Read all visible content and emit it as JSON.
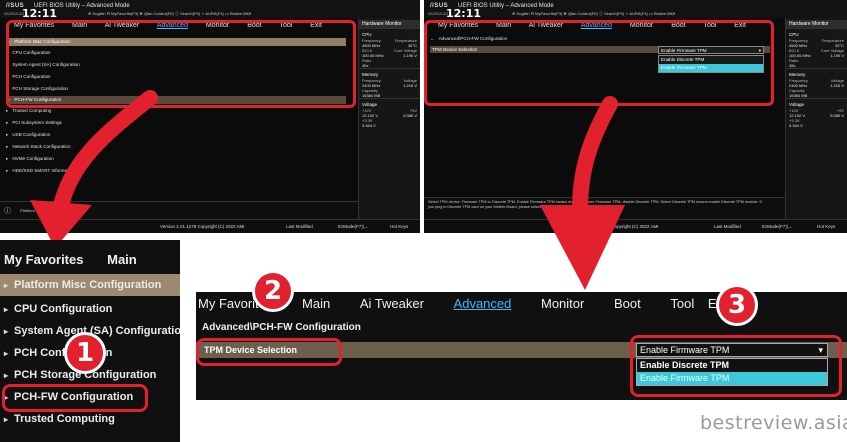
{
  "bios": {
    "logo": "/ISUS",
    "title": "UEFI BIOS Utility – Advanced Mode",
    "date": "05/20/2022",
    "time": "12:11",
    "toolbar": "⊕ English  ⊡ MyFavorite(F3)  ✥ Qfan Control(F6)  ⓘ Search(F9)  ✧ AURA(F4)  ▭ Resize BAR",
    "menu": [
      "My Favorites",
      "Main",
      "Ai Tweaker",
      "Advanced",
      "Monitor",
      "Boot",
      "Tool",
      "Exit"
    ],
    "active_menu": "Advanced",
    "advanced_items": [
      "Platform Misc Configuration",
      "CPU Configuration",
      "System Agent (SA) Configuration",
      "PCH Configuration",
      "PCH Storage Configuration",
      "PCH-FW Configuration",
      "Trusted Computing",
      "PCI Subsystem Settings",
      "USB Configuration",
      "Network Stack Configuration",
      "NVMe Configuration",
      "HDD/SSD SMART Information"
    ],
    "help_left": "Platform Misc Configuration",
    "footer_version": "Version 2.21.1278 Copyright (C) 2022 AMI",
    "footer_version_right": "Version 2.21.1278 Copyright (C) 2022 AMI",
    "last_modified": "Last Modified",
    "ezmode": "EzMode(F7)|→",
    "hotkeys": "Hot Keys",
    "breadcrumb": "Advanced\\PCH-FW Configuration",
    "tpm_label": "TPM Device Selection",
    "tpm_value": "Enable Firmware TPM",
    "tpm_options": [
      "Enable Discrete TPM",
      "Enable Firmware TPM"
    ],
    "tpm_help": "Select TPM device: Firmware TPM or Discrete TPM. Enable Firmware TPM means enable platform Firmware TPM, disable Discrete TPM. Select Discrete TPM means enable Discrete TPM module. If you plug in Discrete TPM card on your Mother Board, please select this option to Discrete TPM."
  },
  "hw_monitor": {
    "title": "Hardware Monitor",
    "cpu": "CPU",
    "freq_label": "Frequency",
    "freq": "4500 MHz",
    "temp_label": "Temperature",
    "temp": "32°C",
    "bclk_label": "BCLK",
    "bclk": "100.00 MHz",
    "corev_label": "Core Voltage",
    "corev": "1.190 V",
    "ratio_label": "Ratio",
    "ratio": "45x",
    "memory": "Memory",
    "mfreq_label": "Frequency",
    "mfreq": "2400 MHz",
    "mvolt_label": "Voltage",
    "mvolt": "1.216 V",
    "cap_label": "Capacity",
    "cap": "16384 MB",
    "voltage": "Voltage",
    "v12_label": "+12V",
    "v12": "12.192 V",
    "v5_label": "+5V",
    "v5": "5.080 V",
    "v33_label": "+3.3V",
    "v33": "3.344 V"
  },
  "zoom_left": {
    "menu_favorites": "My Favorites",
    "menu_main": "Main",
    "items": [
      "Platform Misc Configuration",
      "CPU Configuration",
      "System Agent (SA) Configuration",
      "PCH Configuration",
      "PCH Storage Configuration",
      "PCH-FW Configuration",
      "Trusted Computing"
    ],
    "badge": "1"
  },
  "zoom_right": {
    "menu": [
      "My Favorites",
      "Main",
      "Ai Tweaker",
      "Advanced",
      "Monitor",
      "Boot",
      "Tool",
      "Exit"
    ],
    "breadcrumb": "Advanced\\PCH-FW Configuration",
    "tpm_label": "TPM Device Selection",
    "tpm_value": "Enable Firmware TPM",
    "options": [
      "Enable Discrete TPM",
      "Enable Firmware TPM"
    ],
    "badge2": "2",
    "badge3": "3"
  },
  "watermark": "bestreview.asia",
  "colors": {
    "accent": "#e3202e",
    "highlight": "#8f7e66",
    "tab_active": "#45b4ff",
    "selected_option": "#3cc8d8"
  }
}
